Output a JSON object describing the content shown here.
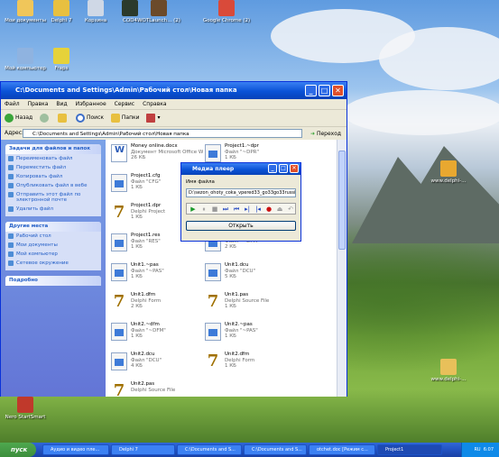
{
  "desktop": {
    "icons": [
      {
        "label": "Мои документы",
        "name": "desktop-icon-my-documents",
        "color": "#f0c65a"
      },
      {
        "label": "Delphi 7",
        "name": "desktop-icon-delphi7",
        "color": "#e8c040"
      },
      {
        "label": "Корзина",
        "name": "desktop-icon-recycle-bin",
        "color": "#cfd8e6"
      },
      {
        "label": "COD4",
        "name": "desktop-icon-cod4",
        "color": "#2b3a2b"
      },
      {
        "label": "WOTLaunch... (2)",
        "name": "desktop-icon-wotlaunch",
        "color": "#6b4a2a"
      },
      {
        "label": "Google Chrome (2)",
        "name": "desktop-icon-chrome",
        "color": "#d94a3a"
      },
      {
        "label": "Мой компьютер",
        "name": "desktop-icon-my-computer",
        "color": "#8fb3e0"
      },
      {
        "label": "Fraps",
        "name": "desktop-icon-fraps",
        "color": "#e6d23a"
      },
      {
        "label": "www.delphi-...",
        "name": "desktop-icon-delphi-site-1",
        "color": "#e8a830"
      },
      {
        "label": "www.delphi-...",
        "name": "desktop-icon-delphi-site-2",
        "color": "#e8c05a"
      },
      {
        "label": "Nero StartSmart",
        "name": "desktop-icon-nero",
        "color": "#c0392b"
      }
    ]
  },
  "explorer": {
    "title": "C:\\Documents and Settings\\Admin\\Рабочий стол\\Новая папка",
    "menu": [
      "Файл",
      "Правка",
      "Вид",
      "Избранное",
      "Сервис",
      "Справка"
    ],
    "toolbar": {
      "back": "Назад",
      "search": "Поиск",
      "folders": "Папки"
    },
    "address_label": "Адрес:",
    "address_value": "C:\\Documents and Settings\\Admin\\Рабочий стол\\Новая папка",
    "go_label": "Переход",
    "panels": [
      {
        "title": "Задачи для файлов и папок",
        "items": [
          "Переименовать файл",
          "Переместить файл",
          "Копировать файл",
          "Опубликовать файл в вебе",
          "Отправить этот файл по электронной почте",
          "Удалить файл"
        ]
      },
      {
        "title": "Другие места",
        "items": [
          "Рабочий стол",
          "Мои документы",
          "Мой компьютер",
          "Сетевое окружение"
        ]
      },
      {
        "title": "Подробно",
        "items": []
      }
    ],
    "files": [
      {
        "name": "Money online.docx",
        "type": "Документ Microsoft Office Word...",
        "size": "26 КБ",
        "icon": "word"
      },
      {
        "name": "Project1.~dpr",
        "type": "Файл \"~DPR\"",
        "size": "1 КБ",
        "icon": "doc"
      },
      {
        "name": "Project1.cfg",
        "type": "Файл \"CFG\"",
        "size": "1 КБ",
        "icon": "doc"
      },
      {
        "name": "Project1.dof",
        "type": "Файл \"DOF\"",
        "size": "",
        "icon": "doc"
      },
      {
        "name": "Project1.dpr",
        "type": "Delphi Project",
        "size": "1 КБ",
        "icon": "delphi"
      },
      {
        "name": "Project1.exe",
        "type": "",
        "size": "",
        "icon": "doc"
      },
      {
        "name": "Project1.res",
        "type": "Файл \"RES\"",
        "size": "1 КБ",
        "icon": "doc"
      },
      {
        "name": "Unit1.~ddp",
        "type": "Файл \"~DFM\"",
        "size": "2 КБ",
        "icon": "doc"
      },
      {
        "name": "Unit1.~pas",
        "type": "Файл \"~PAS\"",
        "size": "1 КБ",
        "icon": "doc"
      },
      {
        "name": "Unit1.dcu",
        "type": "Файл \"DCU\"",
        "size": "5 КБ",
        "icon": "doc"
      },
      {
        "name": "Unit1.dfm",
        "type": "Delphi Form",
        "size": "2 КБ",
        "icon": "delphi"
      },
      {
        "name": "Unit1.pas",
        "type": "Delphi Source File",
        "size": "1 КБ",
        "icon": "delphi"
      },
      {
        "name": "Unit2.~dfm",
        "type": "Файл \"~DFM\"",
        "size": "1 КБ",
        "icon": "doc"
      },
      {
        "name": "Unit2.~pas",
        "type": "Файл \"~PAS\"",
        "size": "1 КБ",
        "icon": "doc"
      },
      {
        "name": "Unit2.dcu",
        "type": "Файл \"DCU\"",
        "size": "4 КБ",
        "icon": "doc"
      },
      {
        "name": "Unit2.dfm",
        "type": "Delphi Form",
        "size": "1 КБ",
        "icon": "delphi"
      },
      {
        "name": "Unit2.pas",
        "type": "Delphi Source File",
        "size": "",
        "icon": "delphi"
      }
    ]
  },
  "media": {
    "title": "Медиа плеер",
    "file_label": "Имя файла",
    "file_value": "D:\\sezon_ohoty_coka_vpered33_go33go33russia3",
    "open_label": "Открыть",
    "controls": [
      {
        "name": "play-button",
        "glyph": "▶",
        "color": "#1a9a2a"
      },
      {
        "name": "pause-button",
        "glyph": "⏸",
        "color": "#999999"
      },
      {
        "name": "stop-button",
        "glyph": "■",
        "color": "#999999"
      },
      {
        "name": "next-button",
        "glyph": "⏭",
        "color": "#1a3fbf"
      },
      {
        "name": "prev-button",
        "glyph": "⏮",
        "color": "#1a3fbf"
      },
      {
        "name": "step-forward-button",
        "glyph": "▸|",
        "color": "#1a3fbf"
      },
      {
        "name": "step-back-button",
        "glyph": "|◂",
        "color": "#1a3fbf"
      },
      {
        "name": "record-button",
        "glyph": "●",
        "color": "#cc1111"
      },
      {
        "name": "eject-button",
        "glyph": "⏏",
        "color": "#999999"
      },
      {
        "name": "back-button",
        "glyph": "↶",
        "color": "#999999"
      }
    ]
  },
  "taskbar": {
    "start": "пуск",
    "tasks": [
      "Аудио и видео пле...",
      "Delphi 7",
      "C:\\Documents and S...",
      "C:\\Documents and S...",
      "otchet.doc [Режим с...",
      "Project1"
    ],
    "lang": "RU",
    "time": "6:07"
  }
}
